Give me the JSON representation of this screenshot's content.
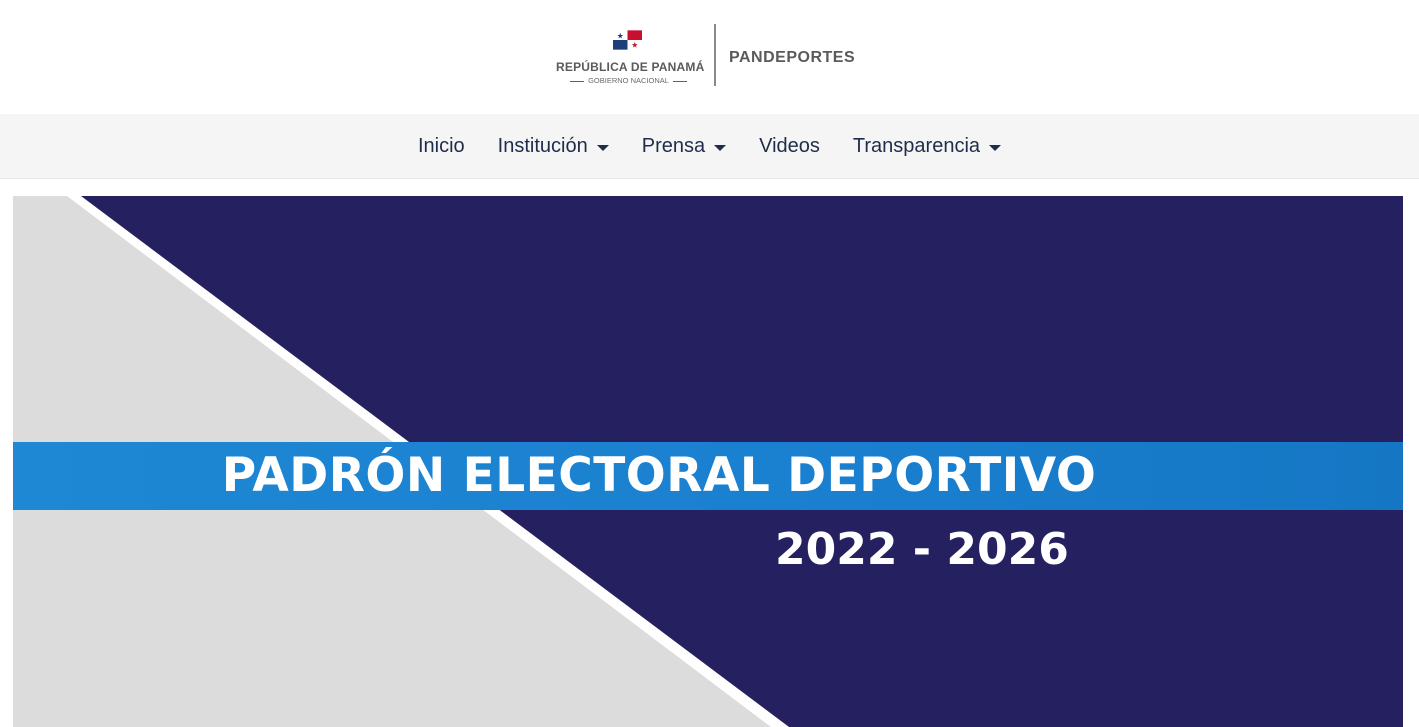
{
  "header": {
    "gov_title": "REPÚBLICA DE PANAMÁ",
    "gov_subtitle": "GOBIERNO NACIONAL",
    "agency_name": "PANDEPORTES",
    "flag_icon": "panama-flag-icon"
  },
  "nav": {
    "items": [
      {
        "label": "Inicio",
        "has_dropdown": false
      },
      {
        "label": "Institución",
        "has_dropdown": true
      },
      {
        "label": "Prensa",
        "has_dropdown": true
      },
      {
        "label": "Videos",
        "has_dropdown": false
      },
      {
        "label": "Transparencia",
        "has_dropdown": true
      }
    ]
  },
  "banner": {
    "title": "PADRÓN ELECTORAL DEPORTIVO",
    "years": "2022 - 2026"
  },
  "colors": {
    "nav_text": "#1f2d4a",
    "banner_navy": "#252060",
    "banner_blue": "#1a7fcf",
    "banner_gray": "#dcdcdc"
  }
}
